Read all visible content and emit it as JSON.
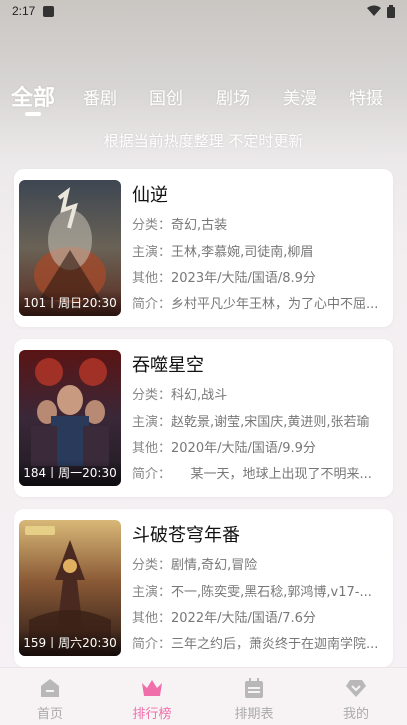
{
  "status_bar": {
    "time": "2:17"
  },
  "tabs": [
    {
      "label": "全部",
      "active": true
    },
    {
      "label": "番剧",
      "active": false
    },
    {
      "label": "国创",
      "active": false
    },
    {
      "label": "剧场",
      "active": false
    },
    {
      "label": "美漫",
      "active": false
    },
    {
      "label": "特摄",
      "active": false
    }
  ],
  "subtitle": "根据当前热度整理 不定时更新",
  "labels": {
    "category": "分类：",
    "cast": "主演：",
    "other": "其他：",
    "intro": "简介："
  },
  "shows": [
    {
      "title": "仙逆",
      "poster_caption": "101丨周日20:30",
      "category": "奇幻,古装",
      "cast": "王林,李慕婉,司徒南,柳眉",
      "other": "2023年/大陆/国语/8.9分",
      "intro": "乡村平凡少年王林，为了心中不屈..."
    },
    {
      "title": "吞噬星空",
      "poster_caption": "184丨周一20:30",
      "category": "科幻,战斗",
      "cast": "赵乾景,谢莹,宋国庆,黄进则,张若瑜",
      "other": "2020年/大陆/国语/9.9分",
      "intro": "　　某一天，地球上出现了不明来..."
    },
    {
      "title": "斗破苍穹年番",
      "poster_caption": "159丨周六20:30",
      "category": "剧情,奇幻,冒险",
      "cast": "不一,陈奕雯,黑石稔,郭鸿博,v17-...",
      "other": "2022年/大陆/国语/7.6分",
      "intro": "三年之约后，萧炎终于在迦南学院..."
    }
  ],
  "bottom_nav": [
    {
      "label": "首页",
      "icon": "home-icon",
      "active": false
    },
    {
      "label": "排行榜",
      "icon": "crown-icon",
      "active": true
    },
    {
      "label": "排期表",
      "icon": "calendar-icon",
      "active": false
    },
    {
      "label": "我的",
      "icon": "diamond-icon",
      "active": false
    }
  ],
  "colors": {
    "accent": "#f06faa",
    "inactive_nav": "#aaaaaa",
    "card_bg": "#ffffff"
  }
}
